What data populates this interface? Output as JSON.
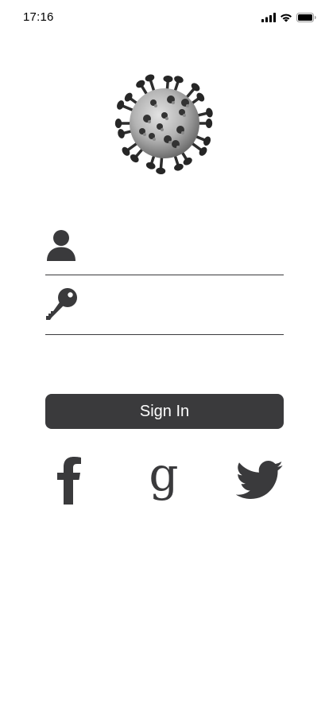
{
  "status_bar": {
    "time": "17:16",
    "icons": [
      "cellular-signal-icon",
      "wifi-icon",
      "battery-icon"
    ]
  },
  "logo": {
    "icon": "coronavirus-icon"
  },
  "login_form": {
    "username": {
      "icon": "user-icon",
      "value": "",
      "placeholder": ""
    },
    "password": {
      "icon": "key-icon",
      "value": "",
      "placeholder": ""
    }
  },
  "sign_in_button": {
    "label": "Sign In"
  },
  "social_login": [
    {
      "icon": "facebook-icon"
    },
    {
      "icon": "google-icon"
    },
    {
      "icon": "twitter-icon"
    }
  ],
  "colors": {
    "button_background": "#3a3a3c",
    "button_text": "#ffffff",
    "icon": "#3a3a3c",
    "background": "#ffffff"
  }
}
